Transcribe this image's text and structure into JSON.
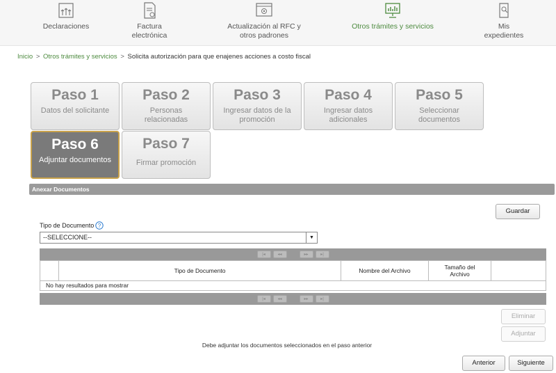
{
  "nav": {
    "items": [
      {
        "label": "Declaraciones",
        "icon": "declaraciones-icon"
      },
      {
        "label": "Factura electrónica",
        "icon": "factura-icon"
      },
      {
        "label": "Actualización al RFC y otros padrones",
        "icon": "rfc-icon"
      },
      {
        "label": "Otros trámites y servicios",
        "icon": "otros-tramites-icon"
      },
      {
        "label": "Mis expedientes",
        "icon": "expedientes-icon"
      }
    ],
    "active_color": "#4c8a3e"
  },
  "breadcrumb": {
    "home": "Inicio",
    "section": "Otros trámites y servicios",
    "current": "Solicita autorización para que enajenes acciones a costo fiscal",
    "separator": ">"
  },
  "steps": [
    {
      "title": "Paso 1",
      "subtitle": "Datos del solicitante"
    },
    {
      "title": "Paso 2",
      "subtitle": "Personas relacionadas"
    },
    {
      "title": "Paso 3",
      "subtitle": "Ingresar datos de la promoción"
    },
    {
      "title": "Paso 4",
      "subtitle": "Ingresar datos adicionales"
    },
    {
      "title": "Paso 5",
      "subtitle": "Seleccionar documentos"
    },
    {
      "title": "Paso 6",
      "subtitle": "Adjuntar documentos"
    },
    {
      "title": "Paso 7",
      "subtitle": "Firmar promoción"
    }
  ],
  "section": {
    "title": "Anexar Documentos"
  },
  "buttons": {
    "guardar": "Guardar",
    "eliminar": "Eliminar",
    "adjuntar": "Adjuntar",
    "anterior": "Anterior",
    "siguiente": "Siguiente"
  },
  "form": {
    "tipo_label": "Tipo de Documento",
    "select_value": "--SELECCIONE--"
  },
  "grid": {
    "columns": [
      "",
      "Tipo de Documento",
      "Nombre del Archivo",
      "Tamaño del Archivo",
      ""
    ],
    "empty_message": "No hay resultados para mostrar",
    "pager": {
      "first": "|◂",
      "prev": "◂◂",
      "next": "▸▸",
      "last": "▸|"
    }
  },
  "note": "Debe adjuntar los documentos seleccionados en el paso anterior"
}
